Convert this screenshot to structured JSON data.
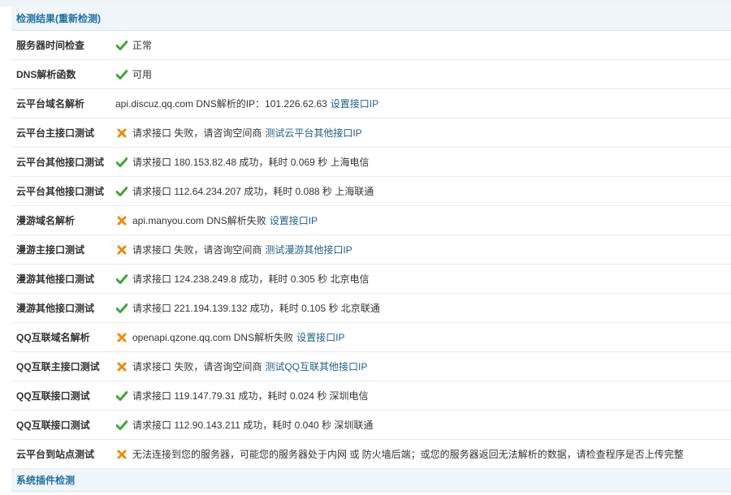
{
  "header": {
    "title": "检测结果",
    "recheck_link": "(重新检测)"
  },
  "rows": [
    {
      "label": "服务器时间检查",
      "status": "ok",
      "text": "正常",
      "link": ""
    },
    {
      "label": "DNS解析函数",
      "status": "ok",
      "text": "可用",
      "link": ""
    },
    {
      "label": "云平台域名解析",
      "status": "none",
      "text": "api.discuz.qq.com DNS解析的IP：101.226.62.63",
      "link": "设置接口IP"
    },
    {
      "label": "云平台主接口测试",
      "status": "fail",
      "text": "请求接口 失败，请咨询空间商",
      "link": "测试云平台其他接口IP"
    },
    {
      "label": "云平台其他接口测试",
      "status": "ok",
      "text": "请求接口 180.153.82.48 成功，耗时 0.069 秒 上海电信",
      "link": ""
    },
    {
      "label": "云平台其他接口测试",
      "status": "ok",
      "text": "请求接口 112.64.234.207 成功，耗时 0.088 秒 上海联通",
      "link": ""
    },
    {
      "label": "漫游域名解析",
      "status": "fail",
      "text": "api.manyou.com DNS解析失败",
      "link": "设置接口IP"
    },
    {
      "label": "漫游主接口测试",
      "status": "fail",
      "text": "请求接口 失败，请咨询空间商",
      "link": "测试漫游其他接口IP"
    },
    {
      "label": "漫游其他接口测试",
      "status": "ok",
      "text": "请求接口 124.238.249.8 成功，耗时 0.305 秒 北京电信",
      "link": ""
    },
    {
      "label": "漫游其他接口测试",
      "status": "ok",
      "text": "请求接口 221.194.139.132 成功，耗时 0.105 秒 北京联通",
      "link": ""
    },
    {
      "label": "QQ互联域名解析",
      "status": "fail",
      "text": "openapi.qzone.qq.com DNS解析失败",
      "link": "设置接口IP"
    },
    {
      "label": "QQ互联主接口测试",
      "status": "fail",
      "text": "请求接口 失败，请咨询空间商",
      "link": "测试QQ互联其他接口IP"
    },
    {
      "label": "QQ互联接口测试",
      "status": "ok",
      "text": "请求接口 119.147.79.31 成功，耗时 0.024 秒 深圳电信",
      "link": ""
    },
    {
      "label": "QQ互联接口测试",
      "status": "ok",
      "text": "请求接口 112.90.143.211 成功，耗时 0.040 秒 深圳联通",
      "link": ""
    },
    {
      "label": "云平台到站点测试",
      "status": "fail",
      "text": "无法连接到您的服务器，可能您的服务器处于内网 或 防火墙后端；或您的服务器返回无法解析的数据，请检查程序是否上传完整",
      "link": ""
    }
  ],
  "footer": {
    "title": "系统插件检测"
  },
  "colors": {
    "ok": "#3aa832",
    "fail": "#f08a00",
    "link": "#1e5f8c",
    "section": "#1e6fa0"
  },
  "icons": {
    "ok": "check-icon",
    "fail": "cross-icon"
  }
}
